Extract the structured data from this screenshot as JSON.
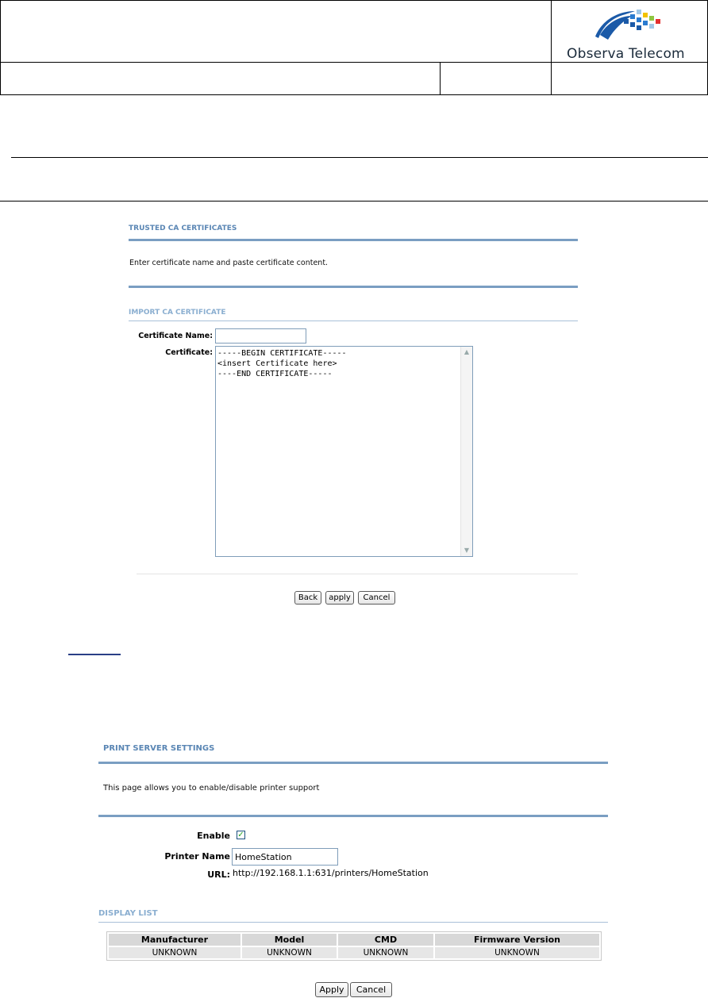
{
  "document": {
    "logo_text": "Observa Telecom"
  },
  "trusted_ca": {
    "title": "TRUSTED CA CERTIFICATES",
    "description": "Enter certificate name and paste certificate content.",
    "import_title": "IMPORT CA CERTIFICATE",
    "cert_name_label": "Certificate Name:",
    "cert_name_value": "",
    "certificate_label": "Certificate:",
    "certificate_value": "-----BEGIN CERTIFICATE-----\n<insert Certificate here>\n----END CERTIFICATE-----",
    "buttons": {
      "back": "Back",
      "apply": "apply",
      "cancel": "Cancel"
    }
  },
  "print_server": {
    "title": "PRINT SERVER SETTINGS",
    "description": "This page allows you to enable/disable printer support",
    "enable_label": "Enable",
    "enable_checked": true,
    "printer_name_label": "Printer Name",
    "printer_name_value": "HomeStation",
    "url_label": "URL:",
    "url_value": "http://192.168.1.1:631/printers/HomeStation",
    "display_list_title": "DISPLAY LIST",
    "table": {
      "headers": [
        "Manufacturer",
        "Model",
        "CMD",
        "Firmware Version"
      ],
      "rows": [
        [
          "UNKNOWN",
          "UNKNOWN",
          "UNKNOWN",
          "UNKNOWN"
        ]
      ]
    },
    "buttons": {
      "apply": "Apply",
      "cancel": "Cancel"
    }
  },
  "colors": {
    "section_title": "#5a86b4",
    "rule": "#7a9ec2"
  }
}
